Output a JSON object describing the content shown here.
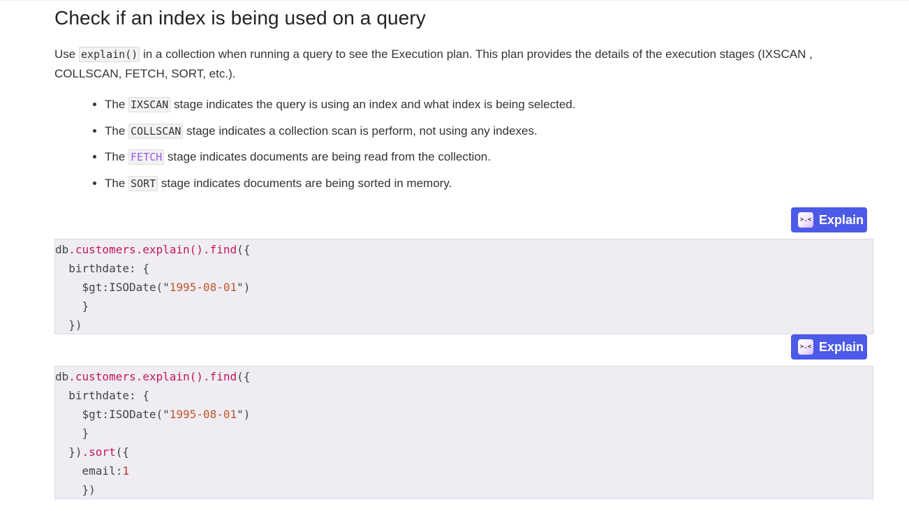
{
  "heading": "Check if an index is being used on a query",
  "intro": {
    "before": "Use ",
    "code": "explain()",
    "after": " in a collection when running a query to see the Execution plan. This plan provides the details of the execution stages (IXSCAN , COLLSCAN, FETCH, SORT, etc.)."
  },
  "stages": [
    {
      "prefix": "The ",
      "code": "IXSCAN",
      "text": " stage indicates the query is using an index and what index is being selected."
    },
    {
      "prefix": "The ",
      "code": "COLLSCAN",
      "text": " stage indicates a collection scan is perform, not using any indexes."
    },
    {
      "prefix": "The ",
      "code": "FETCH",
      "text": " stage indicates documents are being read from the collection."
    },
    {
      "prefix": "The ",
      "code": "SORT",
      "text": " stage indicates documents are being sorted in memory."
    }
  ],
  "explain_button": {
    "label": "Explain",
    "icon_glyph": ">.<"
  },
  "code_blocks": [
    {
      "lines": [
        [
          {
            "t": "db",
            "c": "plain"
          },
          {
            "t": ".customers.explain().find",
            "c": "method"
          },
          {
            "t": "({",
            "c": "plain"
          }
        ],
        [
          {
            "t": "  birthdate: {",
            "c": "plain"
          }
        ],
        [
          {
            "t": "    $gt:ISODate(\"",
            "c": "plain"
          },
          {
            "t": "1995-08-01",
            "c": "string"
          },
          {
            "t": "\")",
            "c": "plain"
          }
        ],
        [
          {
            "t": "    }",
            "c": "plain"
          }
        ],
        [
          {
            "t": "  })",
            "c": "plain"
          }
        ]
      ]
    },
    {
      "lines": [
        [
          {
            "t": "db",
            "c": "plain"
          },
          {
            "t": ".customers.explain().find",
            "c": "method"
          },
          {
            "t": "({",
            "c": "plain"
          }
        ],
        [
          {
            "t": "  birthdate: {",
            "c": "plain"
          }
        ],
        [
          {
            "t": "    $gt:ISODate(\"",
            "c": "plain"
          },
          {
            "t": "1995-08-01",
            "c": "string"
          },
          {
            "t": "\")",
            "c": "plain"
          }
        ],
        [
          {
            "t": "    }",
            "c": "plain"
          }
        ],
        [
          {
            "t": "  })",
            "c": "plain"
          },
          {
            "t": ".sort",
            "c": "method"
          },
          {
            "t": "({",
            "c": "plain"
          }
        ],
        [
          {
            "t": "    email:",
            "c": "plain"
          },
          {
            "t": "1",
            "c": "number"
          }
        ],
        [
          {
            "t": "    })",
            "c": "plain"
          }
        ]
      ]
    }
  ],
  "colors": {
    "button_bg": "#4c5ae8",
    "code_bg": "#efedf3",
    "method": "#c2185b",
    "string": "#c0562a",
    "fetch_code": "#9b59e6"
  }
}
